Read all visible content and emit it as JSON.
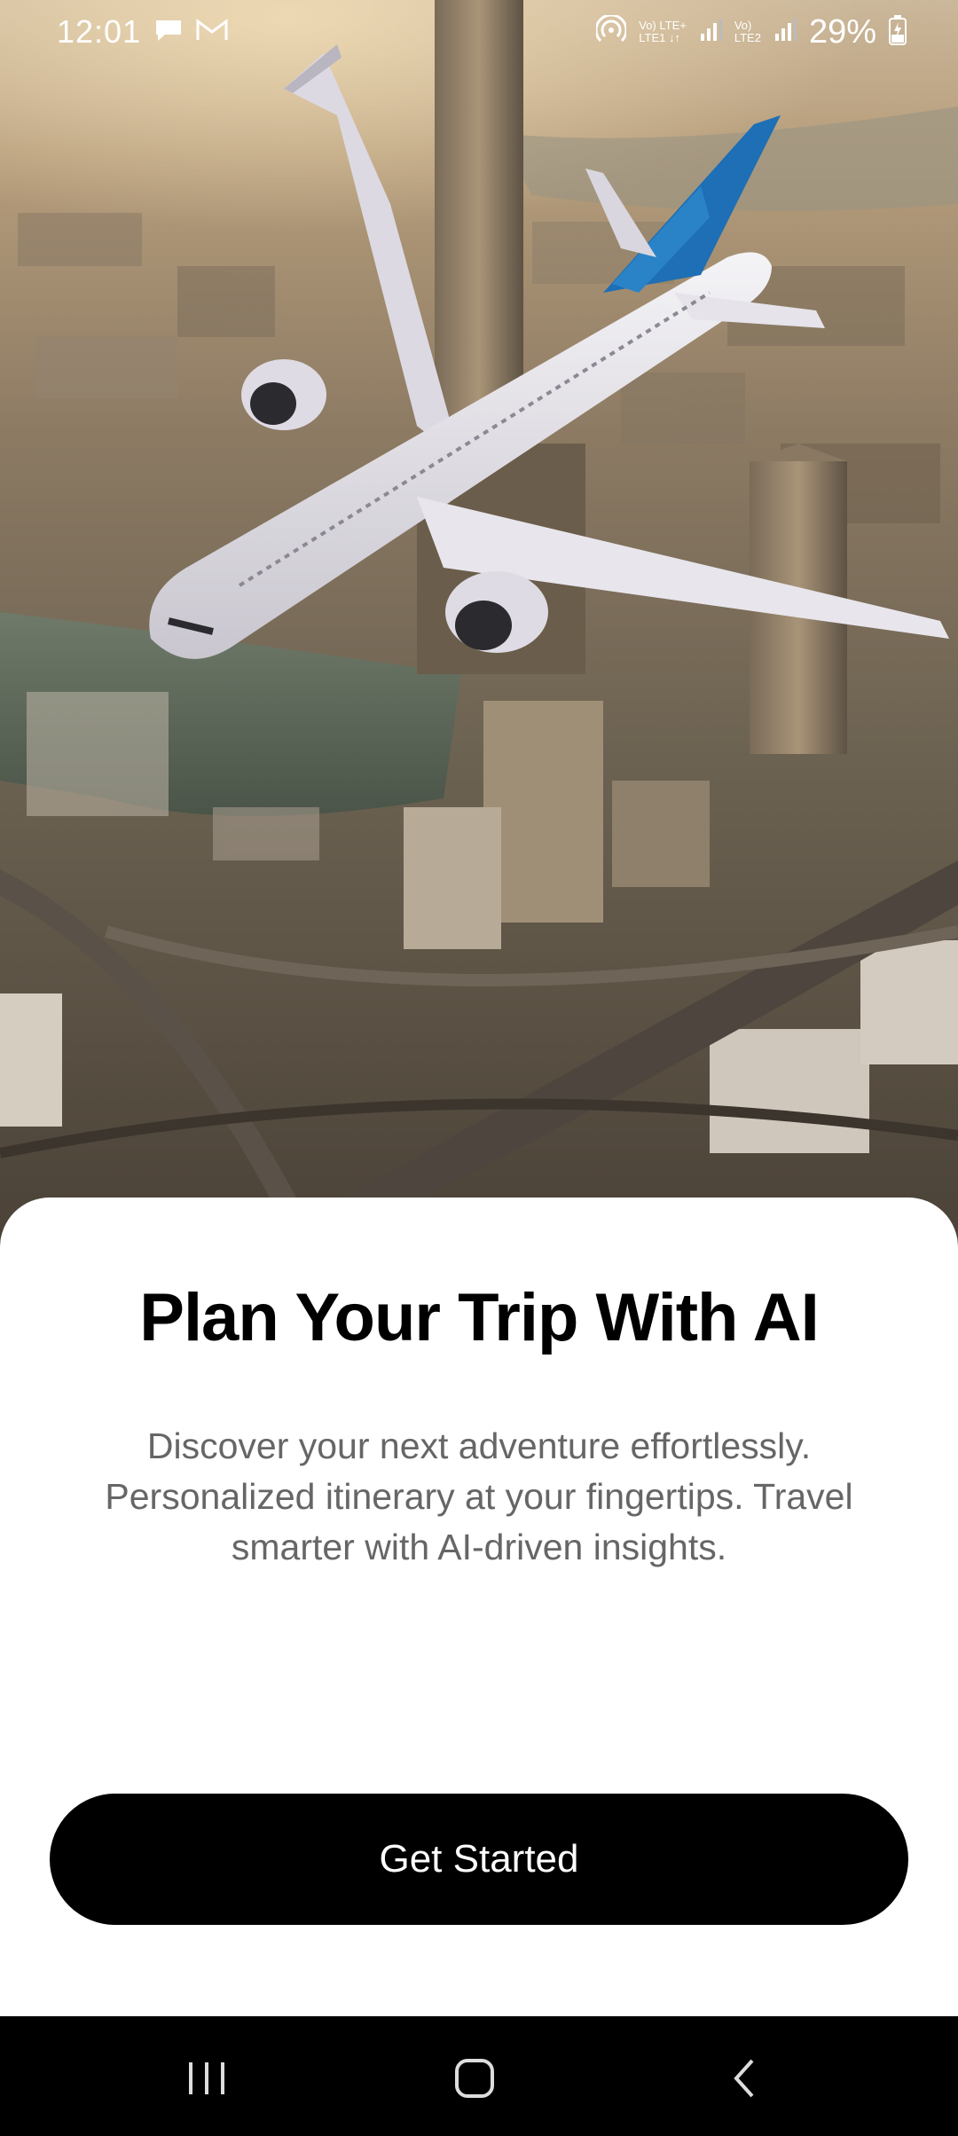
{
  "status_bar": {
    "time": "12:01",
    "network_1": "Vo) LTE+\nLTE1 ↓↑",
    "network_2": "Vo)\nLTE2",
    "battery": "29%"
  },
  "hero": {
    "icon": "airplane-over-city-image"
  },
  "onboarding": {
    "title": "Plan Your Trip With AI",
    "description": "Discover your next adventure effortlessly. Personalized itinerary at your fingertips. Travel smarter with AI-driven insights.",
    "cta_label": "Get Started"
  },
  "nav": {
    "recents_icon": "recents-icon",
    "home_icon": "home-icon",
    "back_icon": "back-icon"
  },
  "colors": {
    "sheet": "#ffffff",
    "cta_bg": "#000000",
    "description_text": "#666666",
    "plane_tail": "#1e6fb5"
  }
}
